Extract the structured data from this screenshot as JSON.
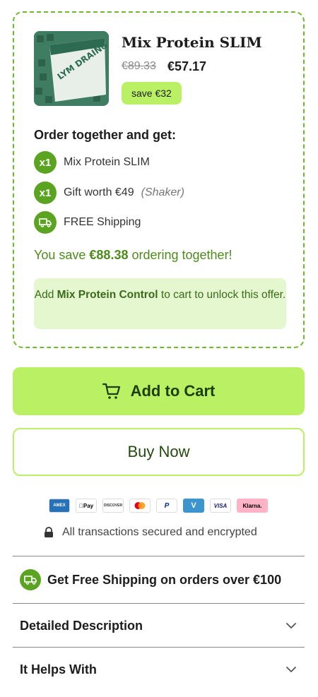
{
  "offer": {
    "product_title": "Mix Protein SLIM",
    "old_price": "€89.33",
    "new_price": "€57.17",
    "save_badge": "save €32",
    "order_heading": "Order together and get:",
    "perks": [
      {
        "badge": "x1",
        "icon": "",
        "text": "Mix Protein SLIM",
        "note": ""
      },
      {
        "badge": "x1",
        "icon": "",
        "text": "Gift worth €49",
        "note": "(Shaker)"
      },
      {
        "badge": "",
        "icon": "truck-icon",
        "text": "FREE Shipping",
        "note": ""
      }
    ],
    "you_save_prefix": "You save ",
    "you_save_amount": "€88.38",
    "you_save_suffix": " ordering together!",
    "unlock_prefix": "Add ",
    "unlock_product": "Mix Protein Control",
    "unlock_suffix": " to cart to unlock this offer.",
    "thumb_text": "LYM DRAIN& DETOX"
  },
  "actions": {
    "add_to_cart": "Add to Cart",
    "buy_now": "Buy Now"
  },
  "payment_methods": [
    {
      "name": "amex-icon",
      "label": "AMEX",
      "bg": "#2671b9",
      "fg": "#ffffff"
    },
    {
      "name": "apple-pay-icon",
      "label": "Pay",
      "bg": "#ffffff",
      "fg": "#000000"
    },
    {
      "name": "discover-icon",
      "label": "DISCOVER",
      "bg": "#ffffff",
      "fg": "#333333"
    },
    {
      "name": "mastercard-icon",
      "label": "",
      "bg": "#ffffff",
      "fg": "#000000"
    },
    {
      "name": "paypal-icon",
      "label": "P",
      "bg": "#ffffff",
      "fg": "#003087"
    },
    {
      "name": "venmo-icon",
      "label": "V",
      "bg": "#3d95ce",
      "fg": "#ffffff"
    },
    {
      "name": "visa-icon",
      "label": "VISA",
      "bg": "#ffffff",
      "fg": "#1a1f71"
    },
    {
      "name": "klarna-icon",
      "label": "Klarna.",
      "bg": "#ffb3c7",
      "fg": "#000000"
    }
  ],
  "secure_text": "All transactions secured and encrypted",
  "shipping_banner": "Get Free Shipping on orders over €100",
  "accordions": [
    {
      "label": "Detailed Description"
    },
    {
      "label": "It Helps With"
    }
  ],
  "colors": {
    "accent": "#b9f064",
    "dark_green": "#5aa421",
    "text_green": "#4d8c1b",
    "light_green_bg": "#e5f7cf"
  }
}
